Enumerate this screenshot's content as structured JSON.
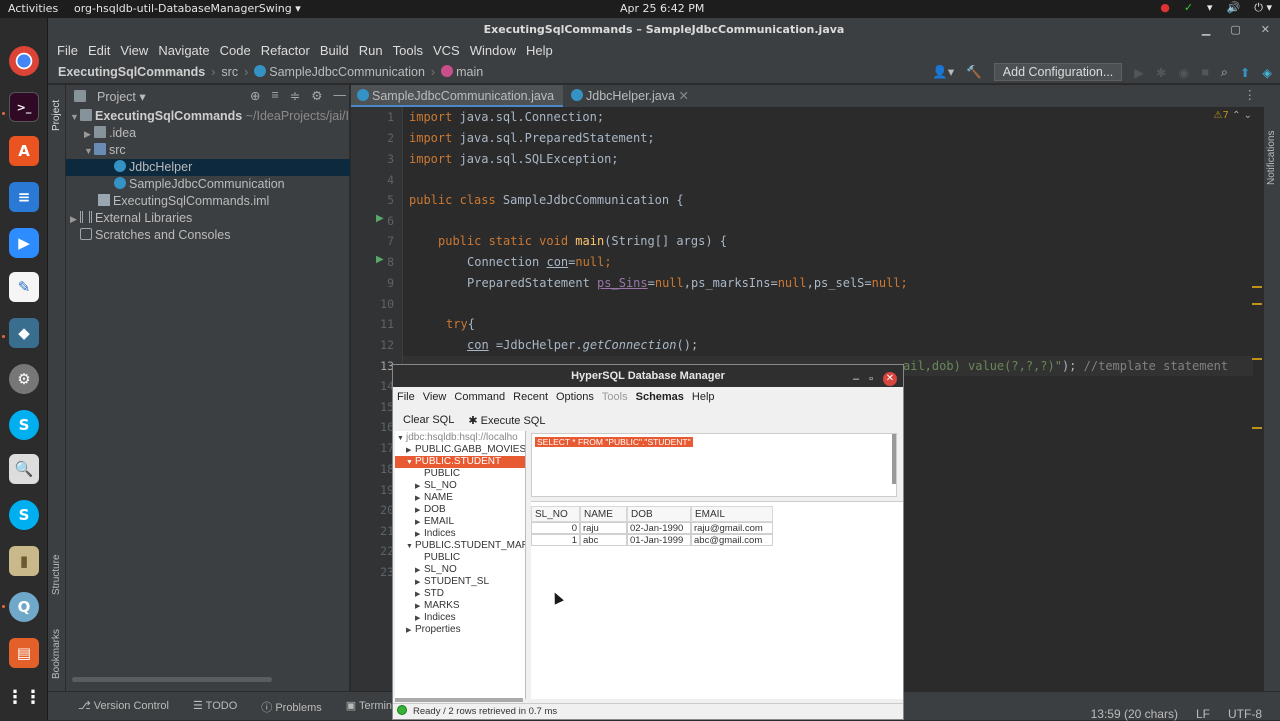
{
  "topbar": {
    "activities": "Activities",
    "app_menu": "org-hsqldb-util-DatabaseManagerSwing ▾",
    "clock": "Apr 25  6:42 PM",
    "tray": [
      "●",
      "✓",
      "▾",
      "🔊",
      "⏻ ▾"
    ]
  },
  "ide": {
    "title": "ExecutingSqlCommands – SampleJdbcCommunication.java",
    "menu": [
      "File",
      "Edit",
      "View",
      "Navigate",
      "Code",
      "Refactor",
      "Build",
      "Run",
      "Tools",
      "VCS",
      "Window",
      "Help"
    ],
    "breadcrumbs": [
      "ExecutingSqlCommands",
      "src",
      "SampleJdbcCommunication",
      "main"
    ],
    "add_configuration": "Add Configuration...",
    "project_panel_title": "Project ▾",
    "tree": [
      {
        "label": "ExecutingSqlCommands",
        "hint": "~/IdeaProjects/jai/I"
      },
      {
        "label": ".idea"
      },
      {
        "label": "src"
      },
      {
        "label": "JdbcHelper"
      },
      {
        "label": "SampleJdbcCommunication"
      },
      {
        "label": "ExecutingSqlCommands.iml"
      },
      {
        "label": "External Libraries"
      },
      {
        "label": "Scratches and Consoles"
      }
    ],
    "tabs": [
      "SampleJdbcCommunication.java",
      "JdbcHelper.java"
    ],
    "warnings": "⚠7",
    "left_strip": [
      "Project",
      "Structure",
      "Bookmarks"
    ],
    "right_strip": "Notifications",
    "bottom_tools": [
      "Version Control",
      "TODO",
      "Problems",
      "Terminal"
    ],
    "status": {
      "position": "13:59 (20 chars)",
      "line_sep": "LF",
      "encoding": "UTF-8"
    }
  },
  "code": {
    "line_numbers": [
      "1",
      "2",
      "3",
      "4",
      "5",
      "6",
      "7",
      "8",
      "9",
      "10",
      "11",
      "12",
      "13",
      "14",
      "15",
      "16",
      "17",
      "18",
      "19",
      "20",
      "21",
      "22",
      "23"
    ],
    "l1_kw": "import",
    "l1": " java.sql.Connection;",
    "l2_kw": "import",
    "l2": " java.sql.PreparedStatement;",
    "l3_kw": "import",
    "l3": " java.sql.SQLException;",
    "l5_kw": "public class",
    "l5": " SampleJdbcCommunication {",
    "l7_kw": "public static void",
    "l7_fn": "main",
    "l7": "(String[] args) {",
    "l8_a": "Connection ",
    "l8_b": "con",
    "l8_c": "=",
    "l8_d": "null",
    "l8_e": ";",
    "l9_a": "PreparedStatement ",
    "l9_b": "ps_Sins",
    "l9_c": "=",
    "l9_d": "null",
    "l9_e": ",ps_marksIns=",
    "l9_f": "null",
    "l9_g": ",ps_selS=",
    "l9_h": "null",
    "l9_i": ";",
    "l11_kw": "try",
    "l11": "{",
    "l12_a": "con",
    "l12_b": " =JdbcHelper.",
    "l12_c": "getConnection",
    "l12_d": "();",
    "l13_str": "ail,dob) value(?,?,?)\"",
    "l13_b": "); ",
    "l13_cm": "//template statement"
  },
  "hsql": {
    "title": "HyperSQL Database Manager",
    "menu": [
      "File",
      "View",
      "Command",
      "Recent",
      "Options",
      "Tools",
      "Schemas",
      "Help"
    ],
    "toolbar": [
      "Clear SQL",
      "Execute SQL"
    ],
    "tree": [
      "jdbc:hsqldb:hsql://localho",
      "PUBLIC.GABB_MOVIES",
      "PUBLIC.STUDENT",
      "PUBLIC",
      "SL_NO",
      "NAME",
      "DOB",
      "EMAIL",
      "Indices",
      "PUBLIC.STUDENT_MARK",
      "PUBLIC",
      "SL_NO",
      "STUDENT_SL",
      "STD",
      "MARKS",
      "Indices",
      "Properties"
    ],
    "query": "SELECT * FROM \"PUBLIC\".\"STUDENT\"",
    "columns": [
      "SL_NO",
      "NAME",
      "DOB",
      "EMAIL"
    ],
    "rows": [
      [
        "0",
        "raju",
        "02-Jan-1990",
        "raju@gmail.com"
      ],
      [
        "1",
        "abc",
        "01-Jan-1999",
        "abc@gmail.com"
      ]
    ],
    "status": "Ready / 2 rows retrieved in 0.7 ms"
  }
}
